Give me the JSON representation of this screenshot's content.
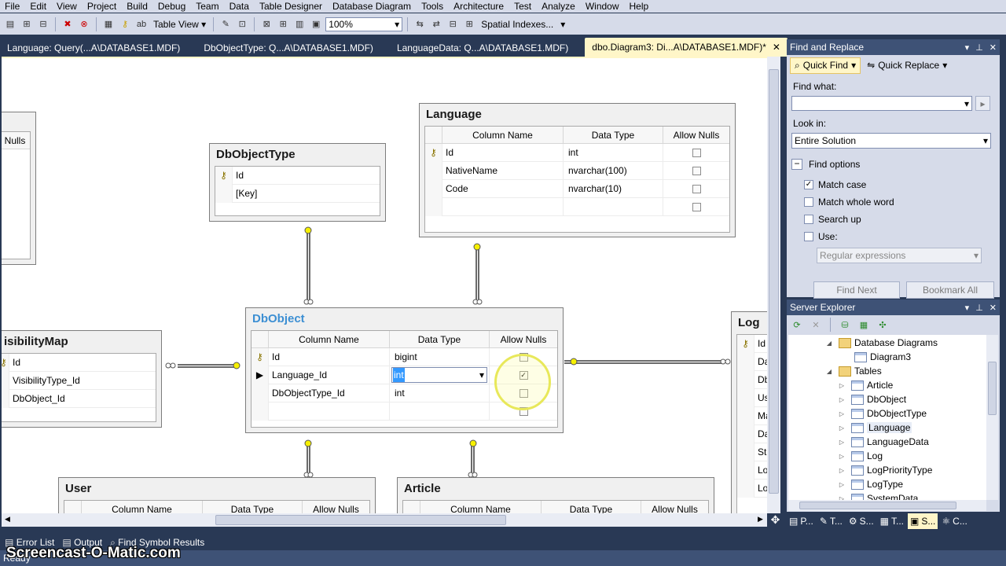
{
  "menu": [
    "File",
    "Edit",
    "View",
    "Project",
    "Build",
    "Debug",
    "Team",
    "Data",
    "Table Designer",
    "Database Diagram",
    "Tools",
    "Architecture",
    "Test",
    "Analyze",
    "Window",
    "Help"
  ],
  "toolbar": {
    "table_view_label": "Table View",
    "zoom_value": "100%",
    "spatial_label": "Spatial Indexes..."
  },
  "doc_tabs": [
    {
      "label": "Language: Query(...A\\DATABASE1.MDF)"
    },
    {
      "label": "DbObjectType: Q...A\\DATABASE1.MDF)"
    },
    {
      "label": "LanguageData: Q...A\\DATABASE1.MDF)"
    },
    {
      "label": "dbo.Diagram3: Di...A\\DATABASE1.MDF)*"
    }
  ],
  "diagram": {
    "headers": {
      "column_name": "Column Name",
      "data_type": "Data Type",
      "allow_nulls": "Allow Nulls"
    },
    "left_partial_header": "Nulls",
    "dbobjecttype": {
      "title": "DbObjectType",
      "rows": [
        "Id",
        "[Key]"
      ]
    },
    "language": {
      "title": "Language",
      "rows": [
        {
          "name": "Id",
          "type": "int"
        },
        {
          "name": "NativeName",
          "type": "nvarchar(100)"
        },
        {
          "name": "Code",
          "type": "nvarchar(10)"
        }
      ]
    },
    "dbobject": {
      "title": "DbObject",
      "rows": [
        {
          "name": "Id",
          "type": "bigint"
        },
        {
          "name": "Language_Id",
          "type": "int"
        },
        {
          "name": "DbObjectType_Id",
          "type": "int"
        }
      ]
    },
    "visibilitymap": {
      "title": "isibilityMap",
      "rows": [
        "Id",
        "VisibilityType_Id",
        "DbObject_Id"
      ]
    },
    "log": {
      "title": "Log",
      "rows": [
        "Id",
        "Da",
        "Db",
        "Us",
        "Ma",
        "Da",
        "Sta",
        "Lo",
        "Lo"
      ]
    },
    "user": {
      "title": "User"
    },
    "article": {
      "title": "Article"
    }
  },
  "find_replace": {
    "title": "Find and Replace",
    "quick_find": "Quick Find",
    "quick_replace": "Quick Replace",
    "find_what_label": "Find what:",
    "look_in_label": "Look in:",
    "look_in_value": "Entire Solution",
    "find_options_label": "Find options",
    "options": [
      {
        "label": "Match case",
        "checked": true
      },
      {
        "label": "Match whole word",
        "checked": false
      },
      {
        "label": "Search up",
        "checked": false
      },
      {
        "label": "Use:",
        "checked": false
      }
    ],
    "use_value": "Regular expressions",
    "find_next": "Find Next",
    "bookmark_all": "Bookmark All"
  },
  "server_explorer": {
    "title": "Server Explorer",
    "nodes": [
      {
        "label": "Database Diagrams",
        "type": "folder",
        "expanded": true
      },
      {
        "label": "Diagram3",
        "type": "diagram"
      },
      {
        "label": "Tables",
        "type": "folder",
        "expanded": true
      },
      {
        "label": "Article",
        "type": "table"
      },
      {
        "label": "DbObject",
        "type": "table"
      },
      {
        "label": "DbObjectType",
        "type": "table"
      },
      {
        "label": "Language",
        "type": "table"
      },
      {
        "label": "LanguageData",
        "type": "table"
      },
      {
        "label": "Log",
        "type": "table"
      },
      {
        "label": "LogPriorityType",
        "type": "table"
      },
      {
        "label": "LogType",
        "type": "table"
      },
      {
        "label": "SystemData",
        "type": "table"
      }
    ]
  },
  "right_bottom_tabs": [
    "P...",
    "T...",
    "S...",
    "T...",
    "S...",
    "C..."
  ],
  "bottom_tabs": [
    "Error List",
    "Output",
    "Find Symbol Results"
  ],
  "status": "Ready",
  "watermark": "Screencast-O-Matic.com",
  "colors": {
    "chrome": "#293955",
    "accent_header": "#3e5276",
    "selected_title": "#3c8fd3",
    "key_icon": "#c8b400",
    "relationship": "#6b6b6b"
  }
}
